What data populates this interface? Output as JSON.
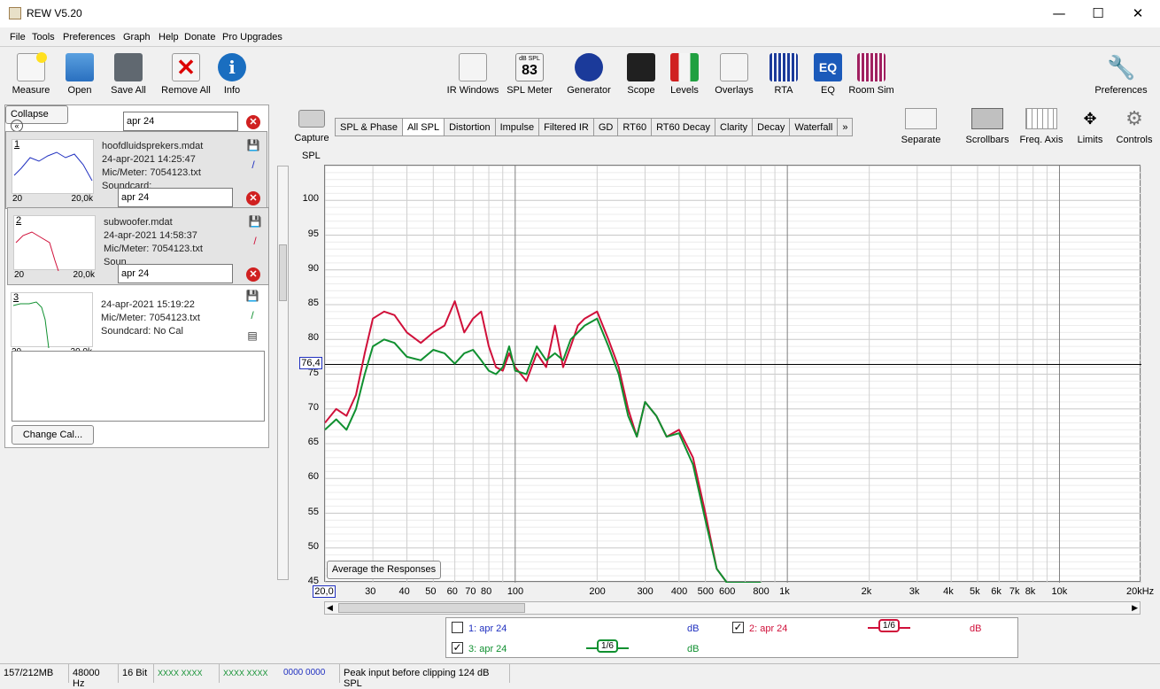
{
  "window": {
    "title": "REW V5.20",
    "minimize": "—",
    "maximize": "☐",
    "close": "✕"
  },
  "menu": [
    "File",
    "Tools",
    "Preferences",
    "Graph",
    "Help",
    "Donate",
    "Pro Upgrades"
  ],
  "toolbar_left": [
    "Measure",
    "Open",
    "Save All",
    "Remove All",
    "Info"
  ],
  "toolbar_mid": [
    "IR Windows",
    "SPL Meter",
    "Generator",
    "Scope",
    "Levels",
    "Overlays",
    "RTA",
    "EQ",
    "Room Sim"
  ],
  "spl_meter": {
    "unit": "dB SPL",
    "value": "83"
  },
  "toolbar_right": "Preferences",
  "graph_tools": [
    "Separate",
    "Scrollbars",
    "Freq. Axis",
    "Limits",
    "Controls"
  ],
  "capture": "Capture",
  "collapse": "Collapse",
  "measurements": [
    {
      "n": "1",
      "name": "apr 24",
      "file": "hoofdluidsprekers.mdat",
      "date": "24-apr-2021 14:25:47",
      "mic": "Mic/Meter: 7054123.txt",
      "card": "Soundcard:",
      "color": "#2030c0"
    },
    {
      "n": "2",
      "name": "apr 24",
      "file": "subwoofer.mdat",
      "date": "24-apr-2021 14:58:37",
      "mic": "Mic/Meter: 7054123.txt",
      "card": "Soun",
      "color": "#d0103a"
    },
    {
      "n": "3",
      "name": "apr 24",
      "file": "",
      "date": "24-apr-2021 15:19:22",
      "mic": "Mic/Meter: 7054123.txt",
      "card": "Soundcard: No Cal",
      "color": "#109030"
    }
  ],
  "thumb_axis": {
    "lo": "20",
    "hi": "20,0k"
  },
  "change_cal": "Change Cal...",
  "tabs": [
    "SPL & Phase",
    "All SPL",
    "Distortion",
    "Impulse",
    "Filtered IR",
    "GD",
    "RT60",
    "RT60 Decay",
    "Clarity",
    "Decay",
    "Waterfall",
    "»"
  ],
  "active_tab": "All SPL",
  "axis": {
    "ylabel": "SPL",
    "cursor": "76,4",
    "xstart": "20,0",
    "xend": "20kHz"
  },
  "yticks": [
    "100",
    "95",
    "90",
    "85",
    "80",
    "75",
    "70",
    "65",
    "60",
    "55",
    "50",
    "45"
  ],
  "xticks": [
    "30",
    "40",
    "50",
    "60",
    "70",
    "80",
    "100",
    "200",
    "300",
    "400",
    "500",
    "600",
    "800",
    "1k",
    "2k",
    "3k",
    "4k",
    "5k",
    "6k",
    "7k",
    "8k",
    "10k"
  ],
  "avg_button": "Average the Responses",
  "legend": [
    {
      "label": "1: apr 24",
      "checked": false,
      "unit": "dB",
      "smooth": "",
      "color": "#2030c0"
    },
    {
      "label": "2: apr 24",
      "checked": true,
      "unit": "dB",
      "smooth": "1/6",
      "color": "#d0103a"
    },
    {
      "label": "3: apr 24",
      "checked": true,
      "unit": "dB",
      "smooth": "1/6",
      "color": "#109030"
    }
  ],
  "status": [
    "157/212MB",
    "48000 Hz",
    "16 Bit",
    "XXXX XXXX",
    "XXXX XXXX",
    "0000 0000",
    "Peak input before clipping 124 dB SPL"
  ],
  "chart_data": {
    "type": "line",
    "ylabel": "SPL",
    "xscale": "log",
    "xlim": [
      20,
      20000
    ],
    "ylim": [
      45,
      105
    ],
    "cursor_y": 76.4,
    "series": [
      {
        "name": "2: apr 24",
        "color": "#d0103a",
        "x": [
          20,
          22,
          24,
          26,
          28,
          30,
          33,
          36,
          40,
          45,
          50,
          55,
          60,
          65,
          70,
          75,
          80,
          85,
          90,
          95,
          100,
          110,
          120,
          130,
          140,
          150,
          160,
          170,
          180,
          200,
          220,
          240,
          260,
          280,
          300,
          330,
          360,
          400,
          450,
          500,
          550,
          600,
          650,
          700,
          750,
          800
        ],
        "y": [
          68,
          70,
          69,
          72,
          78,
          83,
          84,
          83.5,
          81,
          79.5,
          81,
          82,
          85.5,
          81,
          83,
          84,
          79,
          76,
          75.5,
          78,
          76,
          74,
          78,
          76,
          82,
          76,
          79,
          82,
          83,
          84,
          80,
          76,
          70,
          66,
          71,
          69,
          66,
          67,
          63,
          55,
          47,
          45,
          45,
          45,
          45,
          45
        ]
      },
      {
        "name": "3: apr 24",
        "color": "#109030",
        "x": [
          20,
          22,
          24,
          26,
          28,
          30,
          33,
          36,
          40,
          45,
          50,
          55,
          60,
          65,
          70,
          75,
          80,
          85,
          90,
          95,
          100,
          110,
          120,
          130,
          140,
          150,
          160,
          170,
          180,
          200,
          220,
          240,
          260,
          280,
          300,
          330,
          360,
          400,
          450,
          500,
          550,
          600,
          650,
          700,
          750,
          800
        ],
        "y": [
          67,
          68.5,
          67,
          70,
          75,
          79,
          80,
          79.5,
          77.5,
          77,
          78.5,
          78,
          76.5,
          78,
          78.5,
          77,
          75.5,
          75,
          76,
          79,
          75.5,
          75,
          79,
          77,
          78,
          77,
          80,
          81,
          82,
          83,
          79,
          75,
          69,
          66,
          71,
          69,
          66,
          66.5,
          62,
          54,
          47,
          45,
          45,
          45,
          45,
          45
        ]
      }
    ]
  }
}
